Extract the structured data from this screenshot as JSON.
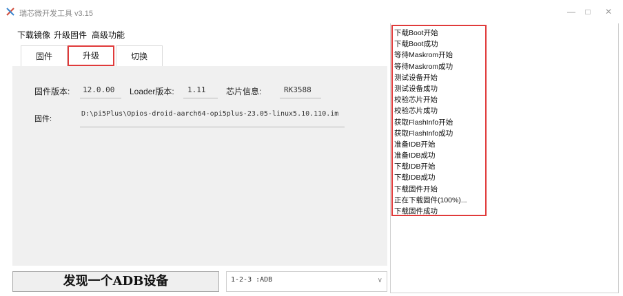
{
  "window": {
    "title": "瑞芯微开发工具 v3.15",
    "minimize": "—",
    "maximize": "□",
    "close": "✕"
  },
  "menu": {
    "items": [
      "下载镜像",
      "升级固件",
      "高级功能"
    ],
    "active_index": 1
  },
  "tabs": {
    "items": [
      "固件",
      "升级",
      "切换"
    ],
    "selected_index": 1
  },
  "info": {
    "firmware_version_label": "固件版本:",
    "firmware_version_value": "12.0.00",
    "loader_version_label": "Loader版本:",
    "loader_version_value": "1.11",
    "chip_info_label": "芯片信息:",
    "chip_info_value": "RK3588"
  },
  "firmware": {
    "label": "固件:",
    "path": "D:\\pi5Plus\\Opios-droid-aarch64-opi5plus-23.05-linux5.10.110.im"
  },
  "status": {
    "message": "发现一个ADB设备",
    "device": "1-2-3 :ADB"
  },
  "log": {
    "lines": [
      "下载Boot开始",
      "下载Boot成功",
      "等待Maskrom开始",
      "等待Maskrom成功",
      "测试设备开始",
      "测试设备成功",
      "校验芯片开始",
      "校验芯片成功",
      "获取FlashInfo开始",
      "获取FlashInfo成功",
      "准备IDB开始",
      "准备IDB成功",
      "下载IDB开始",
      "下载IDB成功",
      "下载固件开始",
      "正在下载固件(100%)...",
      "下载固件成功"
    ]
  },
  "colors": {
    "highlight": "#e03a3a",
    "panel_bg": "#f0f0f0"
  }
}
